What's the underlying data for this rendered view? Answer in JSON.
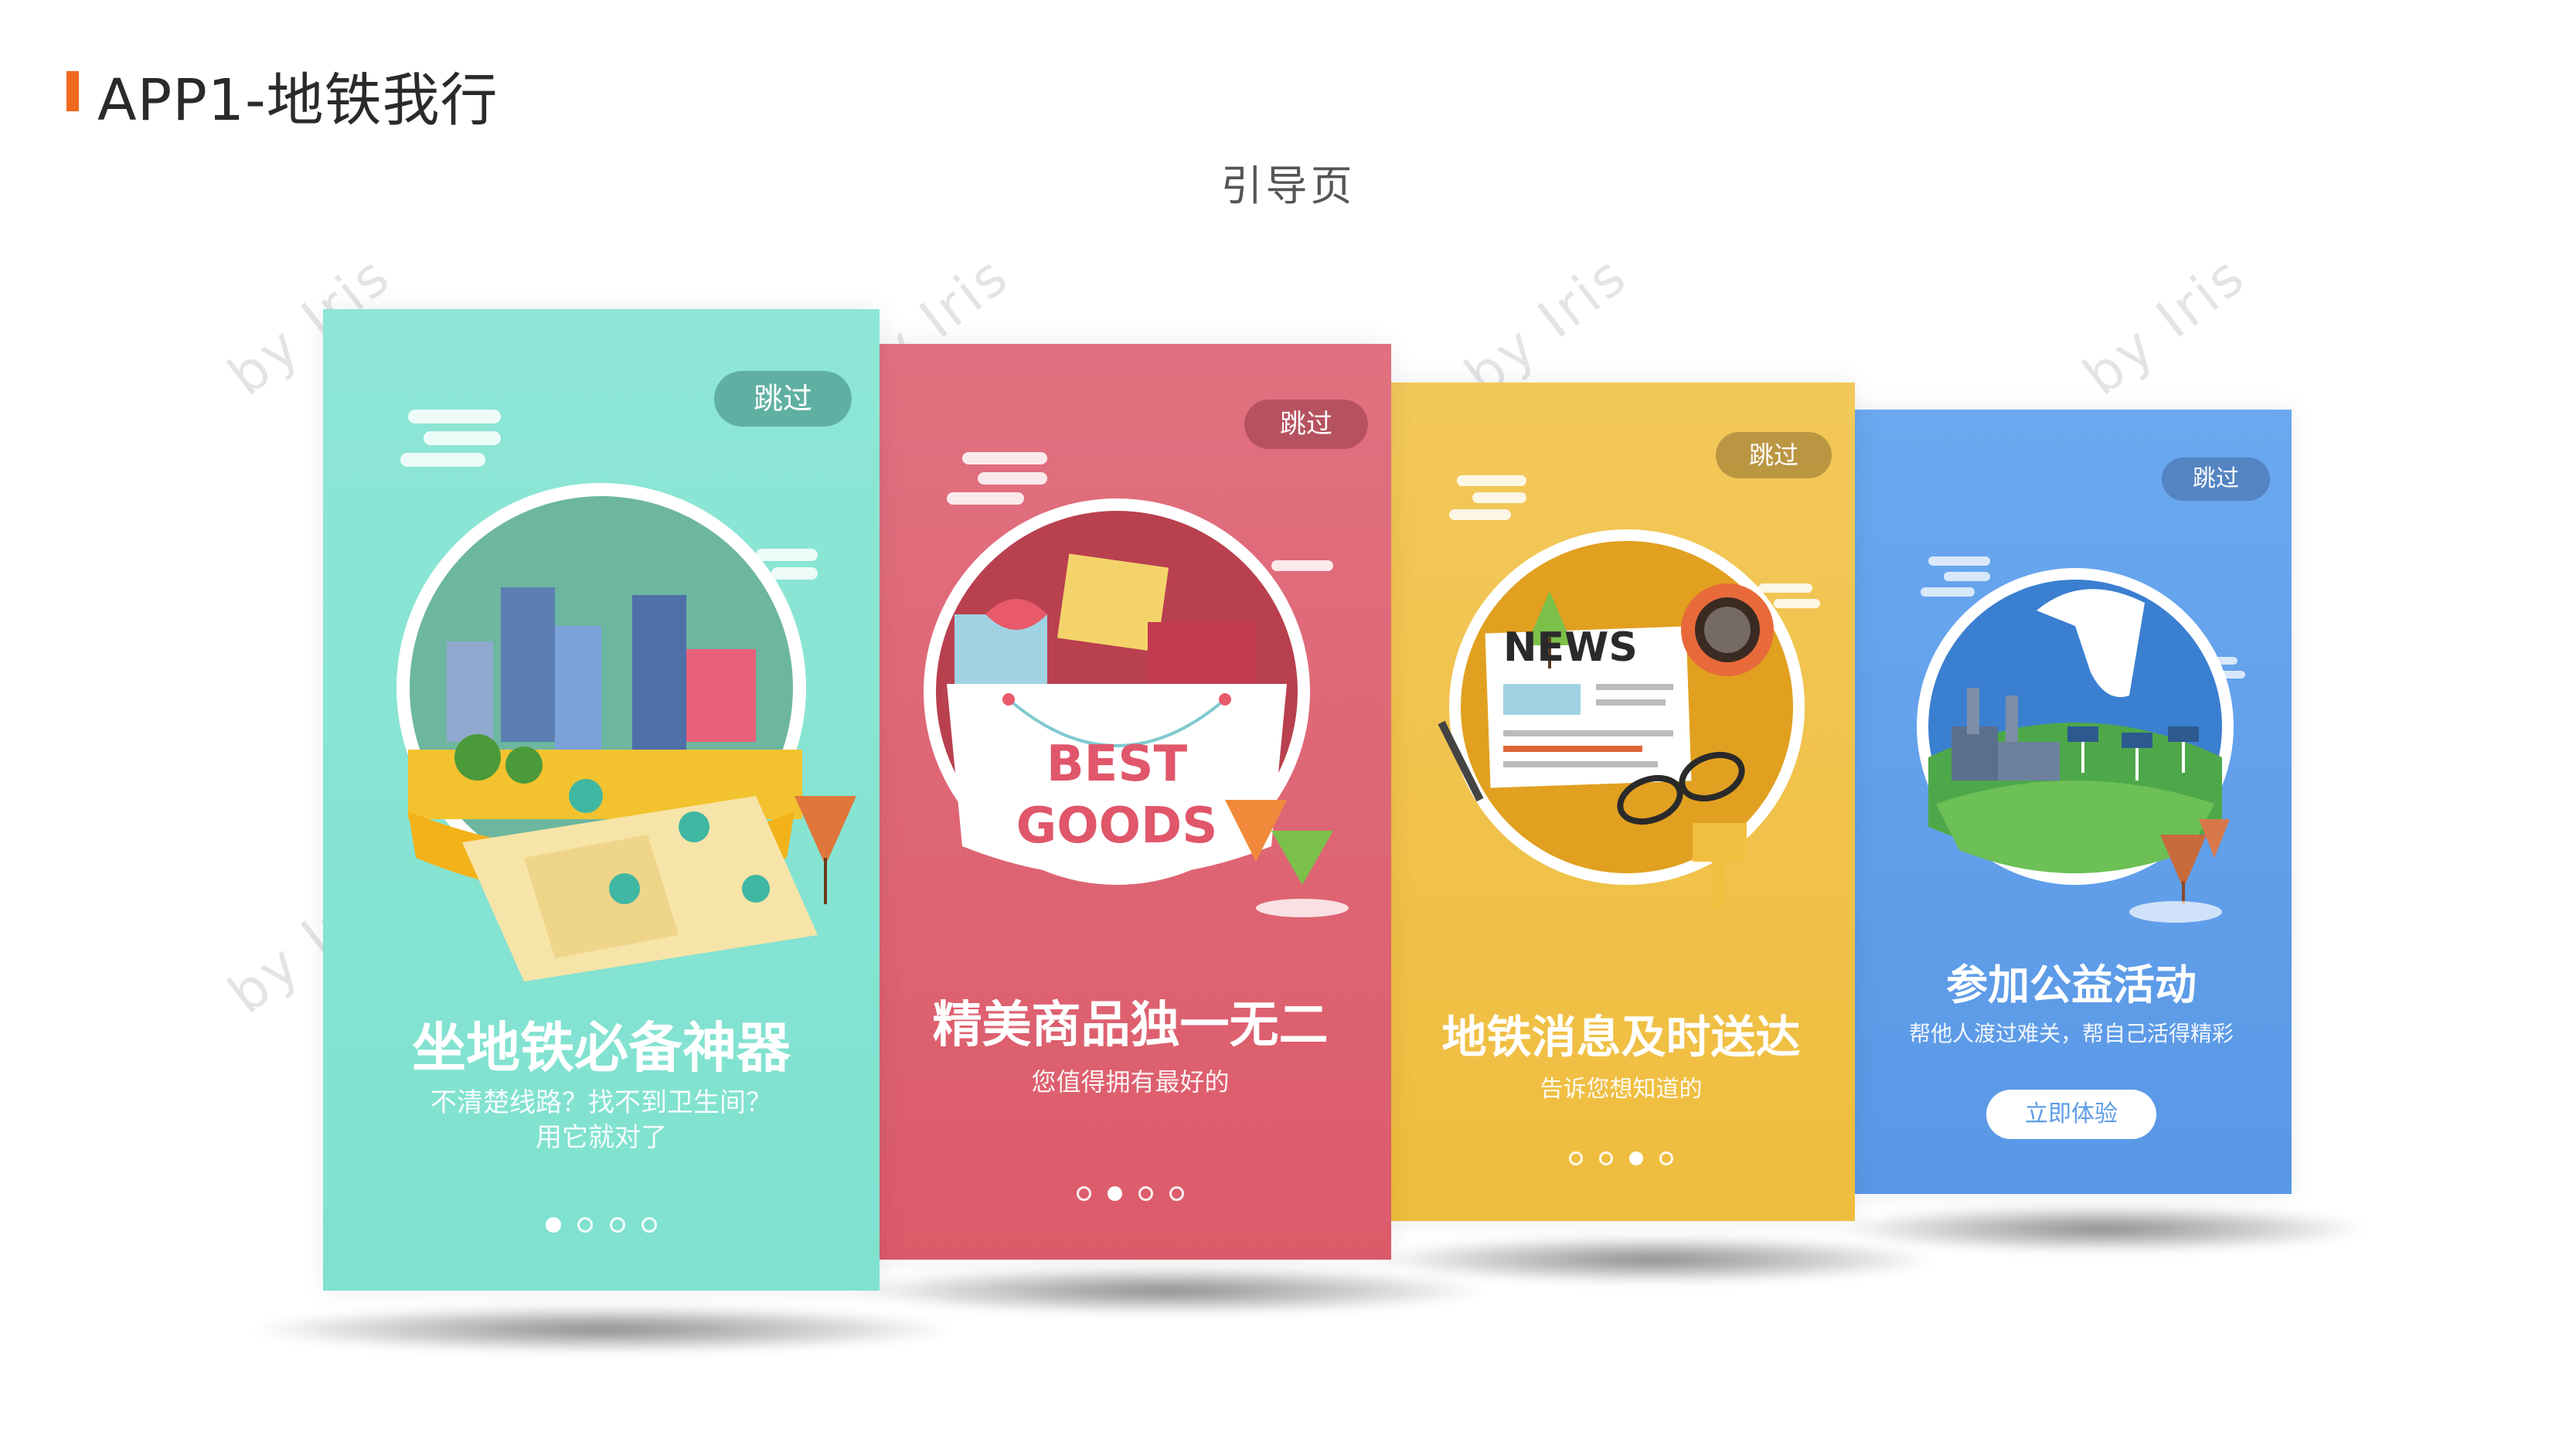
{
  "header": {
    "title": "APP1-地铁我行",
    "subtitle": "引导页"
  },
  "watermark_text": "by Iris",
  "cards": [
    {
      "skip_label": "跳过",
      "heading": "坐地铁必备神器",
      "desc_line1": "不清楚线路？找不到卫生间？",
      "desc_line2": "用它就对了",
      "active_dot": 1,
      "color": "#7fe3cf",
      "illustration": "city-map-illustration"
    },
    {
      "skip_label": "跳过",
      "heading": "精美商品独一无二",
      "desc_line1": "您值得拥有最好的",
      "badge_line1": "BEST",
      "badge_line2": "GOODS",
      "active_dot": 2,
      "color": "#dd5b6b",
      "illustration": "gift-bag-illustration"
    },
    {
      "skip_label": "跳过",
      "heading": "地铁消息及时送达",
      "desc_line1": "告诉您想知道的",
      "news_label": "NEWS",
      "active_dot": 3,
      "color": "#f2c24a",
      "illustration": "newspaper-illustration"
    },
    {
      "skip_label": "跳过",
      "heading": "参加公益活动",
      "desc_line1": "帮他人渡过难关，帮自己活得精彩",
      "cta_label": "立即体验",
      "color": "#5b9ce8",
      "illustration": "charity-hands-illustration"
    }
  ]
}
